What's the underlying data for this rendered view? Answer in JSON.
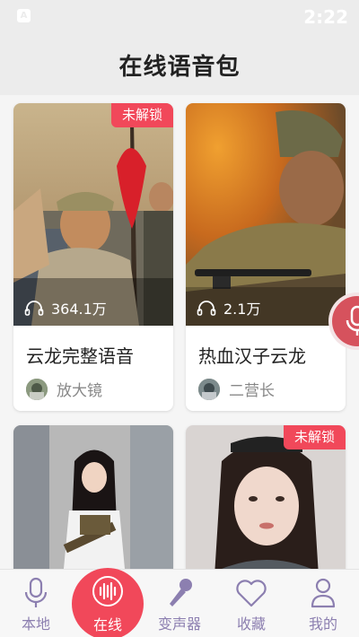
{
  "status": {
    "time": "2:22",
    "app_badge": "A"
  },
  "header": {
    "title": "在线语音包"
  },
  "cards": [
    {
      "name": "云龙完整语音",
      "plays": "364.1万",
      "author": "放大镜",
      "locked": true,
      "lock_label": "未解锁"
    },
    {
      "name": "热血汉子云龙",
      "plays": "2.1万",
      "author": "二营长",
      "locked": false
    },
    {
      "locked": false
    },
    {
      "locked": true,
      "lock_label": "未解锁"
    }
  ],
  "tabs": [
    {
      "label": "本地",
      "icon": "microphone-icon"
    },
    {
      "label": "在线",
      "icon": "waveform-icon",
      "active": true
    },
    {
      "label": "变声器",
      "icon": "karaoke-mic-icon"
    },
    {
      "label": "收藏",
      "icon": "heart-icon"
    },
    {
      "label": "我的",
      "icon": "person-icon"
    }
  ],
  "colors": {
    "accent": "#f1485a",
    "tab_text": "#8c7fb0",
    "header_bg": "#ececec"
  }
}
